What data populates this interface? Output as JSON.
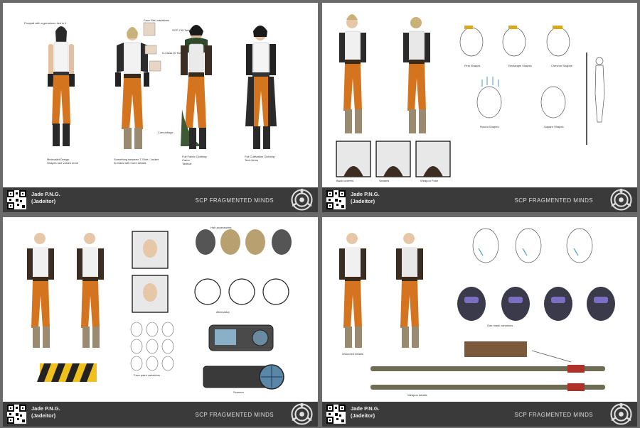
{
  "sheets": [
    {
      "id": "sheet-1",
      "footer": {
        "author_name": "Jade P.N.G.",
        "author_handle": "(Jadeitor)",
        "project": "SCP FRAGMENTED MINDS"
      },
      "notes": [
        "Ponytail with a gemstone tied in it",
        "Minimalist Design",
        "Shapes and values done",
        "Something between T-Shirt / Jacket",
        "D-Class with more details",
        "Face Skin variations",
        "D-Class ID Tattoo",
        "SCP-745 Tattoo",
        "Camouflage",
        "Full Fabric Clothing",
        "Camo",
        "Tactical",
        "Full Cultivation Clothing",
        "Tech items"
      ]
    },
    {
      "id": "sheet-2",
      "footer": {
        "author_name": "Jade P.N.G.",
        "author_handle": "(Jadeitor)",
        "project": "SCP FRAGMENTED MINDS"
      },
      "notes": [
        "First Shapes",
        "Rectangle Shapes",
        "Chevron Shapes",
        "Round Shapes",
        "Square Shapes",
        "Back covered",
        "Variants",
        "Weapon Pose"
      ]
    },
    {
      "id": "sheet-3",
      "footer": {
        "author_name": "Jade P.N.G.",
        "author_handle": "(Jadeitor)",
        "project": "SCP FRAGMENTED MINDS"
      },
      "notes": [
        "Hair accessories",
        "Face paint variations",
        "Alternative",
        "Scanner"
      ]
    },
    {
      "id": "sheet-4",
      "footer": {
        "author_name": "Jade P.N.G.",
        "author_handle": "(Jadeitor)",
        "project": "SCP FRAGMENTED MINDS"
      },
      "notes": [
        "Wounded details",
        "Gas mask variations",
        "Weapon details"
      ]
    }
  ],
  "colors": {
    "background": "#6a6a6a",
    "sheet": "#ffffff",
    "footer": "#3a3a3a",
    "jumpsuit_orange": "#d4741f",
    "caution_yellow": "#f0c01c",
    "dark_clothing": "#2b2b2b"
  },
  "icons": [
    "qr-code-icon",
    "scp-foundation-logo-icon"
  ]
}
